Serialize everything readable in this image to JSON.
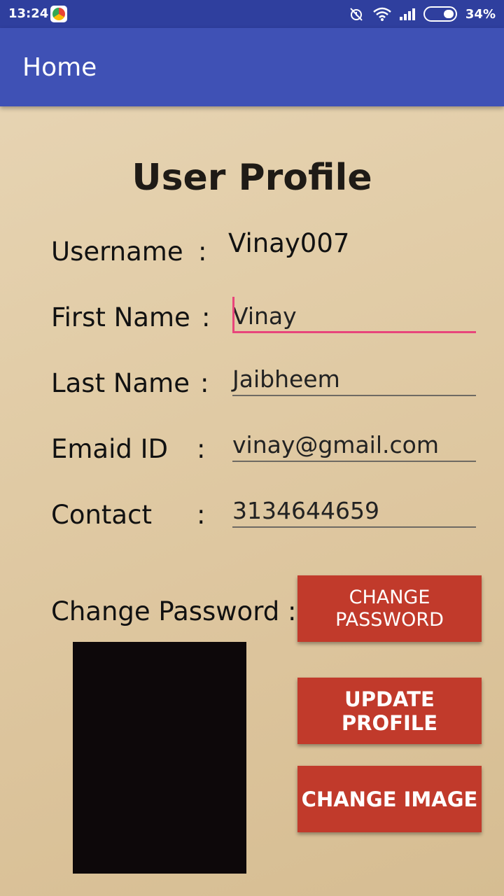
{
  "status_bar": {
    "time": "13:24",
    "battery": "34%",
    "icons": [
      "app-icon",
      "alarm-off-icon",
      "wifi-icon",
      "signal-icon",
      "battery-icon"
    ]
  },
  "toolbar": {
    "title": "Home"
  },
  "profile": {
    "heading": "User Profile",
    "separator": ":",
    "username_label": "Username",
    "username_value": "Vinay007",
    "first_name_label": "First Name",
    "first_name_value": "Vinay",
    "last_name_label": "Last Name",
    "last_name_value": "Jaibheem",
    "email_label": "Emaid ID",
    "email_value": "vinay@gmail.com",
    "contact_label": "Contact",
    "contact_value": "3134644659",
    "change_password_label": "Change Password :"
  },
  "buttons": {
    "change_password": "CHANGE PASSWORD",
    "update_profile": "UPDATE PROFILE",
    "change_image": "CHANGE IMAGE"
  },
  "colors": {
    "status_bar": "#2f3f9e",
    "toolbar": "#3f51b5",
    "button": "#c13a2b",
    "focus_accent": "#e8457b"
  }
}
